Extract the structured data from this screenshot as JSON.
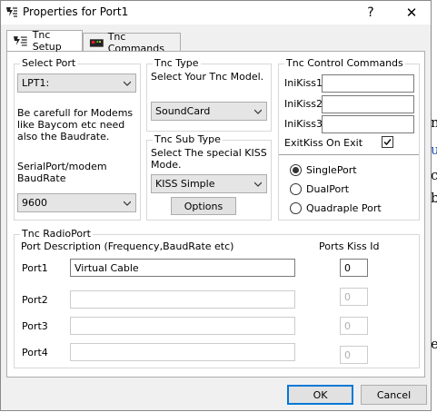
{
  "window": {
    "title": "Properties for Port1",
    "help_label": "?",
    "close_label": "✕"
  },
  "tabs": [
    {
      "label": "Tnc Setup",
      "active": true
    },
    {
      "label": "Tnc Commands",
      "active": false
    }
  ],
  "select_port": {
    "legend": "Select Port",
    "value": "LPT1:",
    "note": "Be carefull for Modems like Baycom etc need also the Baudrate.",
    "baud_label": "SerialPort/modem BaudRate",
    "baud_value": "9600"
  },
  "tnc_type": {
    "legend": "Tnc Type",
    "hint": "Select Your Tnc Model.",
    "value": "SoundCard"
  },
  "tnc_sub_type": {
    "legend": "Tnc Sub Type",
    "hint": "Select The special KISS Mode.",
    "value": "KISS Simple",
    "options_label": "Options"
  },
  "control_commands": {
    "legend": "Tnc Control Commands",
    "inikiss1_label": "IniKiss1",
    "inikiss1_value": "",
    "inikiss2_label": "IniKiss2",
    "inikiss2_value": "",
    "inikiss3_label": "IniKiss3",
    "inikiss3_value": "",
    "exitkiss_label": "ExitKiss On Exit",
    "exitkiss_checked": true,
    "mode_options": [
      {
        "label": "SinglePort",
        "selected": true
      },
      {
        "label": "DualPort",
        "selected": false
      },
      {
        "label": "Quadraple Port",
        "selected": false
      }
    ]
  },
  "radio_port": {
    "legend": "Tnc RadioPort",
    "desc_header": "Port Description (Frequency,BaudRate etc)",
    "kiss_header": "Ports Kiss Id",
    "ports": [
      {
        "label": "Port1",
        "description": "Virtual Cable",
        "kiss_id": "0",
        "enabled": true
      },
      {
        "label": "Port2",
        "description": "",
        "kiss_id": "0",
        "enabled": false
      },
      {
        "label": "Port3",
        "description": "",
        "kiss_id": "0",
        "enabled": false
      },
      {
        "label": "Port4",
        "description": "",
        "kiss_id": "0",
        "enabled": false
      }
    ]
  },
  "footer": {
    "ok_label": "OK",
    "cancel_label": "Cancel"
  },
  "background_letters": [
    "n",
    "u",
    "c",
    "b",
    "e"
  ]
}
